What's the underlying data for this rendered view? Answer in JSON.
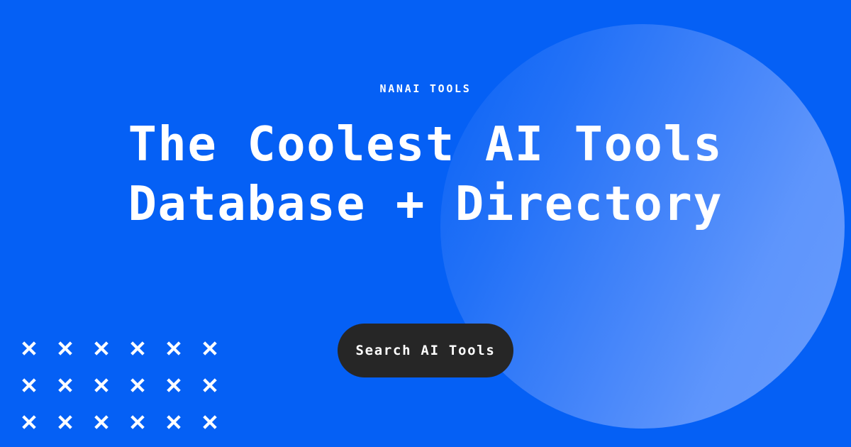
{
  "page": {
    "background_color": "#0560F5",
    "text_color": "#FFFFFF"
  },
  "hero": {
    "eyebrow": "NANAI TOOLS",
    "headline_line_1": "The Coolest AI Tools",
    "headline_line_2": "Database + Directory",
    "headline_full": "The Coolest AI Tools Database + Directory"
  },
  "cta": {
    "label": "Search AI Tools",
    "background_color": "#262626",
    "text_color": "#FFFFFF"
  },
  "decoration": {
    "circle": {
      "icon_name": "gradient-circle",
      "color_from": "#0560F5",
      "color_to": "#689BFC"
    },
    "x_pattern": {
      "icon_name": "x-mark-icon",
      "color": "#FFFFFF",
      "columns": 6,
      "rows": 3,
      "count": 18
    }
  }
}
